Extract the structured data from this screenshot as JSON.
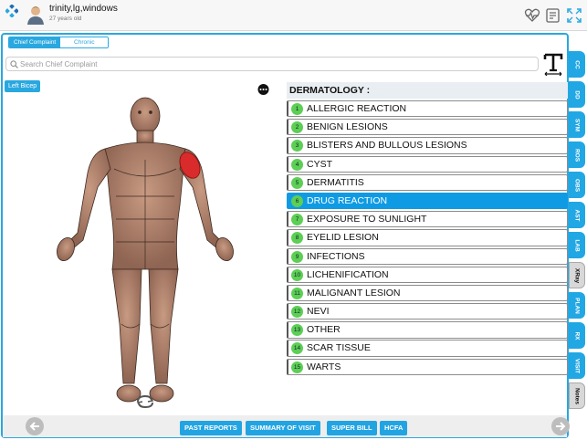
{
  "header": {
    "patient_name": "trinity,lg,windows",
    "patient_age": "27 years old"
  },
  "segment": {
    "tabs": [
      {
        "label": "Chief Complaint",
        "active": true
      },
      {
        "label": "Chronic",
        "active": false
      }
    ]
  },
  "search": {
    "placeholder": "Search Chief Complaint"
  },
  "body_view": {
    "selected_region_label": "Left Bicep"
  },
  "complaints": {
    "category_title": "DERMATOLOGY :",
    "items": [
      {
        "number": "1",
        "label": "ALLERGIC REACTION",
        "selected": false
      },
      {
        "number": "2",
        "label": "BENIGN LESIONS",
        "selected": false
      },
      {
        "number": "3",
        "label": "BLISTERS AND BULLOUS LESIONS",
        "selected": false
      },
      {
        "number": "4",
        "label": "CYST",
        "selected": false
      },
      {
        "number": "5",
        "label": "DERMATITIS",
        "selected": false
      },
      {
        "number": "6",
        "label": "DRUG REACTION",
        "selected": true
      },
      {
        "number": "7",
        "label": "EXPOSURE TO SUNLIGHT",
        "selected": false
      },
      {
        "number": "8",
        "label": "EYELID LESION",
        "selected": false
      },
      {
        "number": "9",
        "label": "INFECTIONS",
        "selected": false
      },
      {
        "number": "10",
        "label": "LICHENIFICATION",
        "selected": false
      },
      {
        "number": "11",
        "label": "MALIGNANT LESION",
        "selected": false
      },
      {
        "number": "12",
        "label": "NEVI",
        "selected": false
      },
      {
        "number": "13",
        "label": "OTHER",
        "selected": false
      },
      {
        "number": "14",
        "label": "SCAR TISSUE",
        "selected": false
      },
      {
        "number": "15",
        "label": "WARTS",
        "selected": false
      }
    ]
  },
  "side_tabs": [
    {
      "label": "CC",
      "style": "blue"
    },
    {
      "label": "DD",
      "style": "blue"
    },
    {
      "label": "SYM",
      "style": "blue"
    },
    {
      "label": "ROS",
      "style": "blue"
    },
    {
      "label": "OBS",
      "style": "blue"
    },
    {
      "label": "AST",
      "style": "blue"
    },
    {
      "label": "LAB",
      "style": "blue"
    },
    {
      "label": "XRay",
      "style": "gray"
    },
    {
      "label": "PLAN",
      "style": "blue"
    },
    {
      "label": "RX",
      "style": "blue"
    },
    {
      "label": "VISIT",
      "style": "blue"
    },
    {
      "label": "Notes",
      "style": "gray"
    }
  ],
  "footer": {
    "buttons": [
      "PAST REPORTS",
      "SUMMARY OF VISIT",
      "SUPER BILL",
      "HCFA"
    ]
  },
  "colors": {
    "accent": "#29a8e0",
    "selected_row": "#0f9be3",
    "number_badge": "#5ccf54",
    "highlight_region": "#d92b2b"
  },
  "icons": [
    "app-logo-icon",
    "user-avatar-icon",
    "heart-monitor-icon",
    "notes-edit-icon",
    "expand-icon",
    "search-icon",
    "text-tool-icon",
    "more-options-icon",
    "rotate-icon",
    "arrow-left-icon",
    "arrow-right-icon"
  ]
}
